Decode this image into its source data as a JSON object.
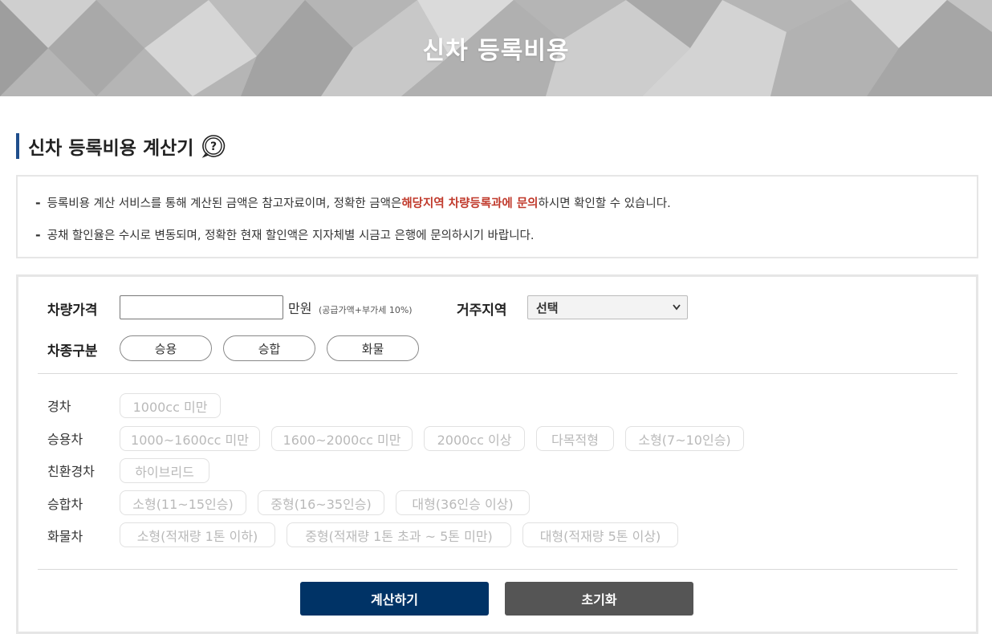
{
  "banner": {
    "title": "신차 등록비용"
  },
  "section": {
    "title": "신차 등록비용 계산기"
  },
  "notice": {
    "line1_pre": "등록비용 계산 서비스를 통해 계산된 금액은 참고자료이며, 정확한 금액은 ",
    "line1_em": "해당지역 차량등록과에 문의",
    "line1_post": "하시면 확인할 수 있습니다.",
    "line2": "공채 할인율은 수시로 변동되며, 정확한 현재 할인액은 지자체별 시금고 은행에 문의하시기 바랍니다.",
    "em_color": "#c0392b"
  },
  "form": {
    "price_label": "차량가격",
    "price_value": "",
    "price_unit": "만원",
    "price_note": "(공급가액+부가세 10%)",
    "region_label": "거주지역",
    "region_selected": "선택",
    "type_label": "차종구분",
    "types": [
      "승용",
      "승합",
      "화물"
    ]
  },
  "categories": [
    {
      "label": "경차",
      "options": [
        "1000cc 미만"
      ]
    },
    {
      "label": "승용차",
      "options": [
        "1000~1600cc 미만",
        "1600~2000cc 미만",
        "2000cc 이상",
        "다목적형",
        "소형(7~10인승)"
      ]
    },
    {
      "label": "친환경차",
      "options": [
        "하이브리드"
      ]
    },
    {
      "label": "승합차",
      "options": [
        "소형(11~15인승)",
        "중형(16~35인승)",
        "대형(36인승 이상)"
      ]
    },
    {
      "label": "화물차",
      "options": [
        "소형(적재량 1톤 이하)",
        "중형(적재량 1톤 초과 ~ 5톤 미만)",
        "대형(적재량 5톤 이상)"
      ]
    }
  ],
  "actions": {
    "calculate": "계산하기",
    "reset": "초기화"
  },
  "colors": {
    "primary": "#003366",
    "reset": "#555555",
    "accent_bar": "#1f4e8c"
  },
  "icons": {
    "help": "help-question-icon",
    "select": "chevron-down-icon"
  }
}
